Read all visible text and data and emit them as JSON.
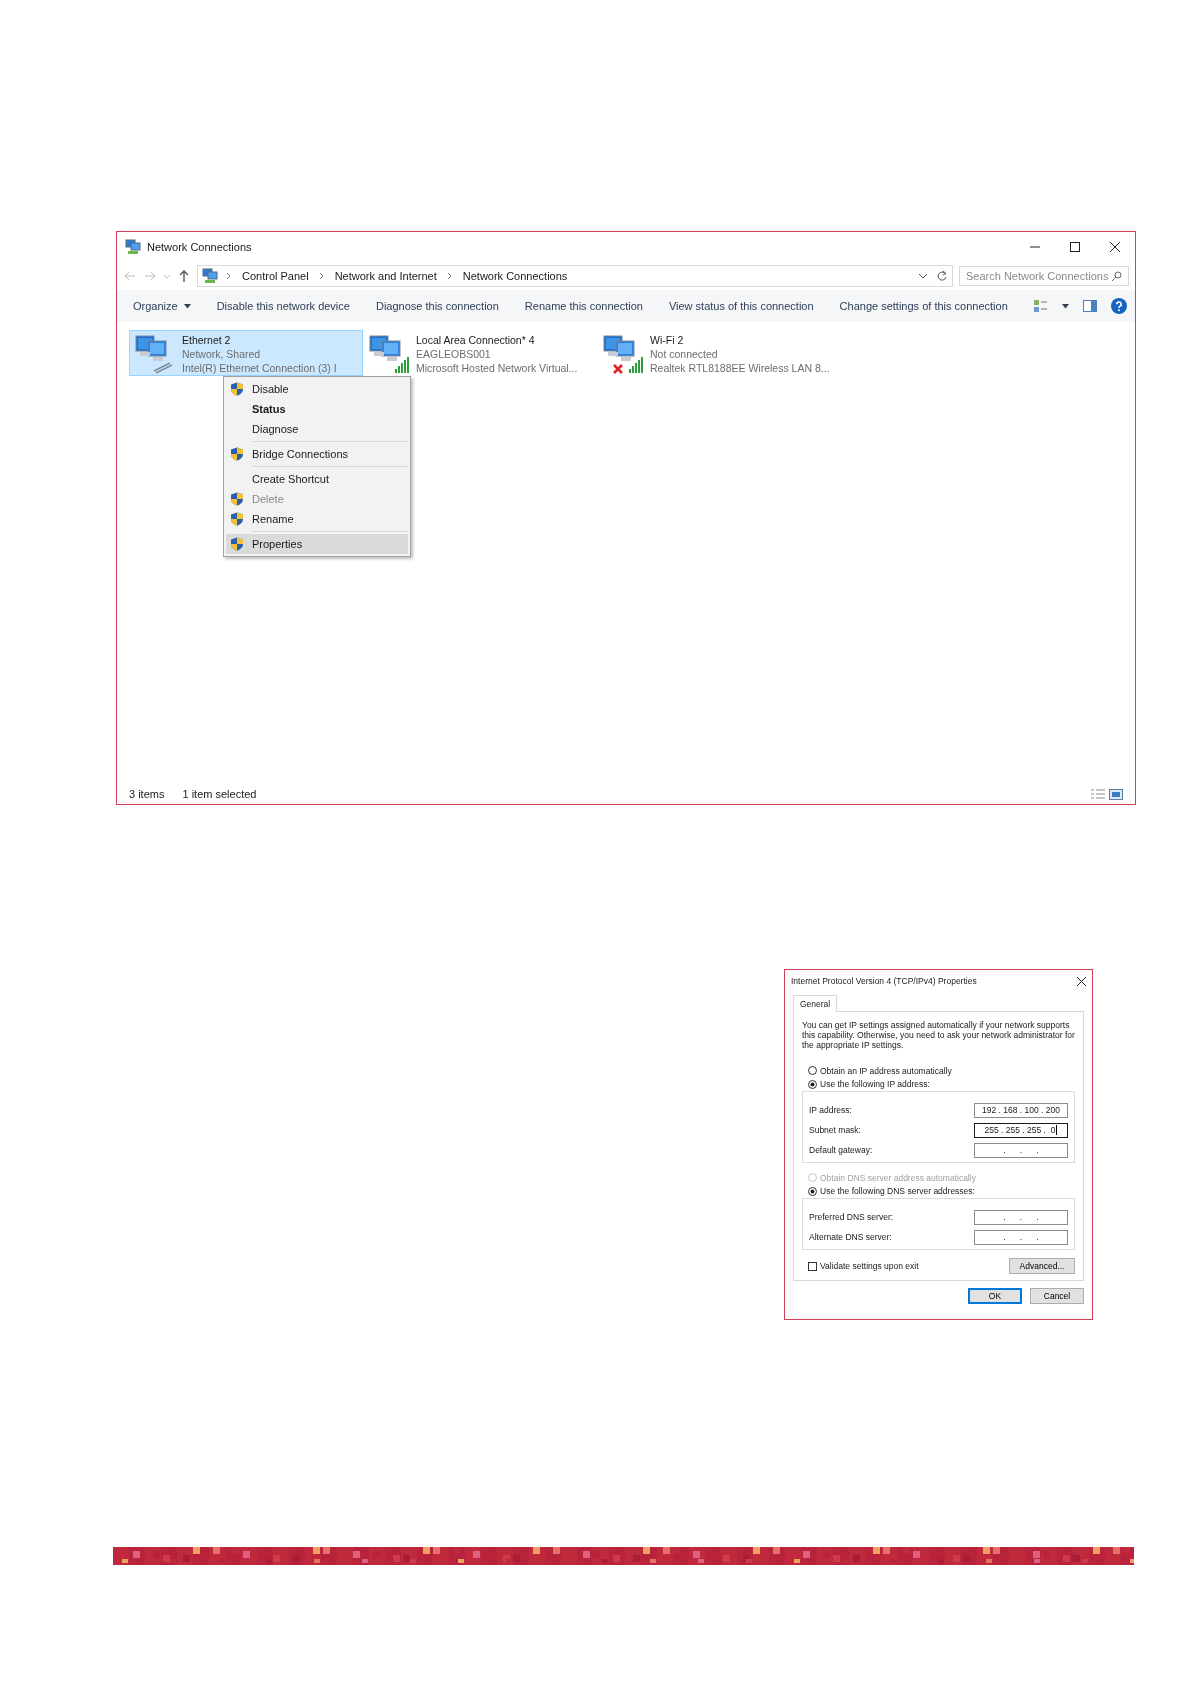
{
  "window": {
    "title": "Network Connections"
  },
  "address_bar": {
    "breadcrumbs": [
      "Control Panel",
      "Network and Internet",
      "Network Connections"
    ]
  },
  "search": {
    "placeholder": "Search Network Connections"
  },
  "toolbar": [
    {
      "label": "Organize",
      "kind": "menu"
    },
    {
      "label": "Disable this network device",
      "kind": "command"
    },
    {
      "label": "Diagnose this connection",
      "kind": "command"
    },
    {
      "label": "Rename this connection",
      "kind": "command"
    },
    {
      "label": "View status of this connection",
      "kind": "command"
    },
    {
      "label": "Change settings of this connection",
      "kind": "command"
    }
  ],
  "connections": [
    {
      "name": "Ethernet 2",
      "status": "Network, Shared",
      "device": "Intel(R) Ethernet Connection (3) I",
      "kind": "wired",
      "connected": true,
      "selected": true
    },
    {
      "name": "Local Area Connection* 4",
      "status": "EAGLEOBS001",
      "device": "Microsoft Hosted Network Virtual...",
      "kind": "wireless",
      "connected": true,
      "selected": false
    },
    {
      "name": "Wi-Fi 2",
      "status": "Not connected",
      "device": "Realtek RTL8188EE Wireless LAN 8...",
      "kind": "wireless",
      "connected": false,
      "selected": false
    }
  ],
  "context_menu": [
    {
      "kind": "item",
      "label": "Disable",
      "shield": true,
      "bold": false,
      "disabled": false,
      "highlighted": false
    },
    {
      "kind": "item",
      "label": "Status",
      "shield": false,
      "bold": true,
      "disabled": false,
      "highlighted": false
    },
    {
      "kind": "item",
      "label": "Diagnose",
      "shield": false,
      "bold": false,
      "disabled": false,
      "highlighted": false
    },
    {
      "kind": "separator"
    },
    {
      "kind": "item",
      "label": "Bridge Connections",
      "shield": true,
      "bold": false,
      "disabled": false,
      "highlighted": false
    },
    {
      "kind": "separator"
    },
    {
      "kind": "item",
      "label": "Create Shortcut",
      "shield": false,
      "bold": false,
      "disabled": false,
      "highlighted": false
    },
    {
      "kind": "item",
      "label": "Delete",
      "shield": true,
      "bold": false,
      "disabled": true,
      "highlighted": false
    },
    {
      "kind": "item",
      "label": "Rename",
      "shield": true,
      "bold": false,
      "disabled": false,
      "highlighted": false
    },
    {
      "kind": "separator"
    },
    {
      "kind": "item",
      "label": "Properties",
      "shield": true,
      "bold": false,
      "disabled": false,
      "highlighted": true
    }
  ],
  "status_bar": {
    "count": "3 items",
    "selection": "1 item selected"
  },
  "dialog": {
    "title": "Internet Protocol Version 4 (TCP/IPv4) Properties",
    "tabs": [
      {
        "label": "General",
        "selected": true
      }
    ],
    "description": "You can get IP settings assigned automatically if your network supports this capability. Otherwise, you need to ask your network administrator for the appropriate IP settings.",
    "ip_options": [
      {
        "label": "Obtain an IP address automatically",
        "selected": false,
        "disabled": false
      },
      {
        "label": "Use the following IP address:",
        "selected": true,
        "disabled": false
      }
    ],
    "ip_fields": [
      {
        "label": "IP address:",
        "value": "192 . 168 . 100 . 200",
        "focused": false
      },
      {
        "label": "Subnet mask:",
        "value": "255 . 255 . 255 .  0",
        "focused": true
      },
      {
        "label": "Default gateway:",
        "value": ".      .      .",
        "focused": false
      }
    ],
    "dns_options": [
      {
        "label": "Obtain DNS server address automatically",
        "selected": false,
        "disabled": true
      },
      {
        "label": "Use the following DNS server addresses:",
        "selected": true,
        "disabled": false
      }
    ],
    "dns_fields": [
      {
        "label": "Preferred DNS server:",
        "value": ".      .      .",
        "focused": false
      },
      {
        "label": "Alternate DNS server:",
        "value": ".      .      .",
        "focused": false
      }
    ],
    "validate": {
      "label": "Validate settings upon exit",
      "checked": false
    },
    "advanced_button": "Advanced...",
    "buttons": [
      {
        "label": "OK",
        "default": true
      },
      {
        "label": "Cancel",
        "default": false
      }
    ]
  }
}
